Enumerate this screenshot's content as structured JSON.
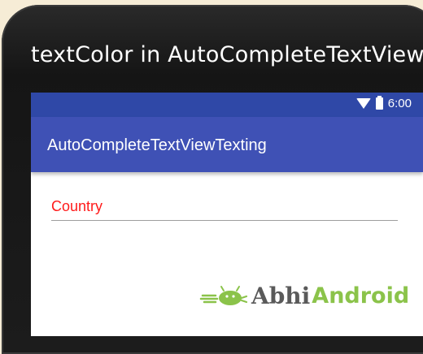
{
  "phone": {
    "caption": "textColor in AutoCompleteTextView"
  },
  "status_bar": {
    "time": "6:00"
  },
  "app_bar": {
    "title": "AutoCompleteTextViewTexting"
  },
  "input": {
    "placeholder": "Country",
    "value": ""
  },
  "logo": {
    "abhi": "Abhi",
    "android": "Android"
  },
  "colors": {
    "status_bar": "#2f48a7",
    "app_bar": "#3f51b5",
    "input_text": "#ff1a1a",
    "logo_green": "#8bc34a"
  }
}
